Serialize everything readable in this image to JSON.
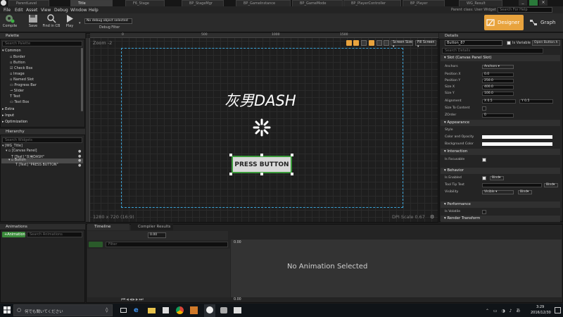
{
  "tabs": [
    "ParentLevel",
    "Title",
    "F6_Stage",
    "BP_StageMgr",
    "BP_GameInstance",
    "BP_GameMode",
    "BP_PlayerController",
    "BP_Player",
    "WG_Result"
  ],
  "tabs_active": 1,
  "parent_class": "Parent class: User Widget",
  "help_search_placeholder": "Search For Help",
  "menu": [
    "File",
    "Edit",
    "Asset",
    "View",
    "Debug",
    "Window",
    "Help"
  ],
  "toolbar": {
    "compile": "Compile",
    "save": "Save",
    "find": "Find in CB",
    "play": "Play",
    "debug_select": "No debug object selected",
    "debug_filter": "Debug Filter"
  },
  "mode": {
    "designer": "Designer",
    "graph": "Graph"
  },
  "palette": {
    "title": "Palette",
    "search": "Search Palette",
    "common": "Common",
    "items": [
      "Border",
      "Button",
      "Check Box",
      "Image",
      "Named Slot",
      "Progress Bar",
      "Slider",
      "Text",
      "Text Box"
    ],
    "cats": [
      "Extra",
      "Input",
      "Optimization"
    ]
  },
  "hierarchy": {
    "title": "Hierarchy",
    "search": "Search Widgets",
    "items": [
      "[WG_Title]",
      "[Canvas Panel]",
      "[Text] \"灰男DASH\"",
      "Button",
      "[Text] \"PRESS BUTTON\""
    ]
  },
  "canvas": {
    "zoom": "Zoom -2",
    "title": "灰男DASH",
    "button": "PRESS BUTTON",
    "resolution": "1280 x 720 (16:9)",
    "dpi": "DPI Scale 0.67",
    "screen_size": "Screen Size",
    "fill_screen": "Fill Screen",
    "ruler": [
      "0",
      "500",
      "1000",
      "1500"
    ]
  },
  "details": {
    "title": "Details",
    "name": "Button_87",
    "is_variable": "Is Variable",
    "open": "Open Button.h",
    "search": "Search Details",
    "slot_section": "Slot (Canvas Panel Slot)",
    "anchors": "Anchors",
    "anchors_val": "Anchors",
    "pos_x": "Position X",
    "pos_x_val": "0.0",
    "pos_y": "Position Y",
    "pos_y_val": "250.0",
    "size_x": "Size X",
    "size_x_val": "400.0",
    "size_y": "Size Y",
    "size_y_val": "100.0",
    "alignment": "Alignment",
    "align_x": "X  0.5",
    "align_y": "Y  0.5",
    "size_to_content": "Size To Content",
    "zorder": "ZOrder",
    "zorder_val": "0",
    "appearance": "Appearance",
    "style": "Style",
    "color_opacity": "Color and Opacity",
    "bg_color": "Background Color",
    "interaction": "Interaction",
    "is_focusable": "Is Focusable",
    "behavior": "Behavior",
    "is_enabled": "Is Enabled",
    "bind": "Bind",
    "tooltip": "Tool Tip Text",
    "visibility": "Visibility",
    "visibility_val": "Visible",
    "performance": "Performance",
    "is_volatile": "Is Volatile",
    "render_transform": "Render Transform"
  },
  "animations": {
    "title": "Animations",
    "add": "+Animation",
    "search": "Search Animations"
  },
  "timeline": {
    "tab1": "Timeline",
    "tab2": "Compiler Results",
    "fps": "0.00",
    "filter": "Filter",
    "time": "0.00",
    "time_bottom": "0.00",
    "empty": "No Animation Selected"
  },
  "taskbar": {
    "search": "何でも聞いてください",
    "time": "3:29",
    "date": "2016/12/30"
  },
  "colors": {
    "accent": "#e8a33d",
    "selection": "#3a9a3a",
    "canvas_border": "#3aa3d8"
  }
}
